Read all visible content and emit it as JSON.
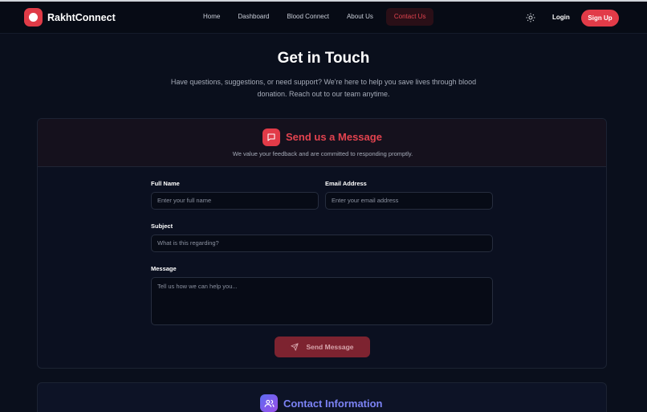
{
  "nav": {
    "brand": "RakhtConnect",
    "links": [
      "Home",
      "Dashboard",
      "Blood Connect",
      "About Us",
      "Contact Us"
    ],
    "active_link": "Contact Us",
    "login": "Login",
    "signup": "Sign Up"
  },
  "hero": {
    "title": "Get in Touch",
    "subtitle": "Have questions, suggestions, or need support? We're here to help you save lives through blood donation. Reach out to our team anytime."
  },
  "form_card": {
    "title": "Send us a Message",
    "subtitle": "We value your feedback and are committed to responding promptly.",
    "full_name_label": "Full Name",
    "full_name_placeholder": "Enter your full name",
    "email_label": "Email Address",
    "email_placeholder": "Enter your email address",
    "subject_label": "Subject",
    "subject_placeholder": "What is this regarding?",
    "message_label": "Message",
    "message_placeholder": "Tell us how we can help you...",
    "send_label": "Send Message"
  },
  "info_card": {
    "title": "Contact Information"
  },
  "colors": {
    "accent": "#e23b48",
    "background": "#0a0f1c",
    "info_accent": "#7c83f5"
  },
  "icons": [
    "logo-icon",
    "sun-icon",
    "message-icon",
    "send-icon",
    "users-icon"
  ]
}
